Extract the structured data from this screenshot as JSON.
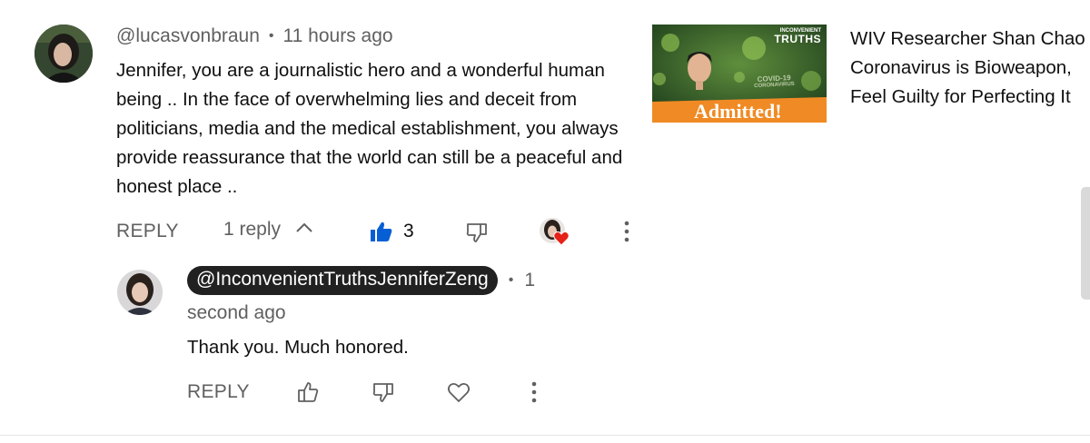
{
  "comment": {
    "author": "@lucasvonbraun",
    "separator": "•",
    "time": "11 hours ago",
    "text_lines": [
      "Jennifer, you are a journalistic hero and a wonderful human",
      "being .. In the face of overwhelming lies and deceit from",
      "politicians, media and the medical establishment, you always",
      "provide reassurance that the world can still be a peaceful and",
      "honest place .."
    ],
    "reply_label": "REPLY",
    "replies_label": "1 reply",
    "like_count": "3",
    "icons": [
      "like-filled-icon",
      "dislike-icon",
      "creator-heart-icon",
      "more-vert-icon",
      "chevron-up-icon"
    ]
  },
  "reply": {
    "author": "@InconvenientTruthsJenniferZeng",
    "separator": "•",
    "time_part1": "1",
    "time_part2": "second ago",
    "text": "Thank you. Much honored.",
    "reply_label": "REPLY",
    "icons": [
      "like-outline-icon",
      "dislike-icon",
      "heart-outline-icon",
      "more-vert-icon"
    ]
  },
  "suggestion": {
    "title_lines": [
      "WIV Researcher Shan Chao",
      "Coronavirus is Bioweapon,",
      "Feel Guilty for Perfecting It"
    ],
    "thumbnail": {
      "badge_top": "INCONVENIENT",
      "badge_main": "TRUTHS",
      "banner": "Admitted!",
      "overlay_line1": "COVID-19",
      "overlay_line2": "CORONAVIRUS"
    }
  },
  "colors": {
    "accent_like": "#065fd4",
    "chip_bg": "#212121",
    "muted": "#606060",
    "banner": "#f08a24"
  }
}
